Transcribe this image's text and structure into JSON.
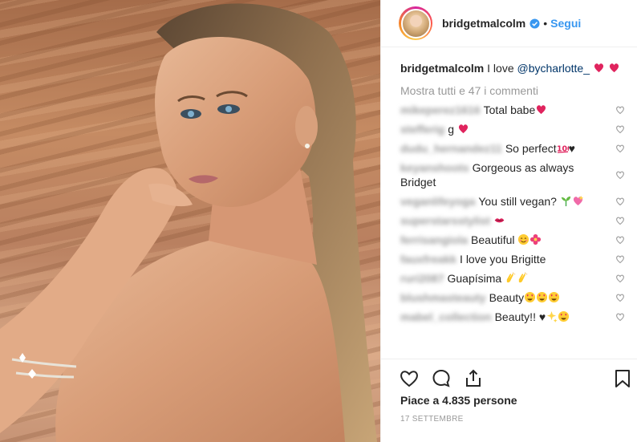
{
  "post": {
    "username": "bridgetmalcolm",
    "separator": "•",
    "follow_label": "Segui",
    "caption_user": "bridgetmalcolm",
    "caption_text": "I love ",
    "caption_mention": "@bycharlotte_",
    "show_all_label": "Mostra tutti e 47 i commenti",
    "likes_label": "Piace a 4.835 persone",
    "date_label": "17 SETTEMBRE"
  },
  "comments": [
    {
      "user": "mikeperez1616",
      "text": "Total babe",
      "emoji": [
        "heart"
      ]
    },
    {
      "user": "stefferig",
      "text": "g ",
      "emoji": [
        "heart"
      ]
    },
    {
      "user": "dudu_hernandez11",
      "text": "So perfect",
      "emoji": [
        "hundred"
      ],
      "suffix": "♥"
    },
    {
      "user": "keyanshoots",
      "text": "Gorgeous as always Bridget",
      "emoji": []
    },
    {
      "user": "veganlifeyoga",
      "text": "You still vegan? ",
      "emoji": [
        "seedling",
        "sparkle-heart"
      ]
    },
    {
      "user": "superstarsstylist",
      "text": "",
      "emoji": [
        "kiss"
      ]
    },
    {
      "user": "ferrisangiola",
      "text": "Beautiful ",
      "emoji": [
        "blush",
        "flower"
      ]
    },
    {
      "user": "fauxfreakk",
      "text": "I love you Brigitte",
      "emoji": []
    },
    {
      "user": "ruri2087",
      "text": "Guapísima ",
      "emoji": [
        "clap",
        "clap"
      ]
    },
    {
      "user": "blushmasteauty",
      "text": "Beauty",
      "emoji": [
        "hearteyes",
        "hearteyes",
        "hearteyes"
      ]
    },
    {
      "user": "mabel_collection",
      "text": "Beauty!! ♥",
      "emoji": [
        "sparkles",
        "hearteyes"
      ]
    }
  ],
  "icons": {
    "verified": "verified-badge-icon",
    "like": "heart-outline-icon",
    "comment": "speech-bubble-icon",
    "share": "share-icon",
    "save": "bookmark-icon"
  },
  "colors": {
    "accent": "#3897f0",
    "heart_red": "#e0245e",
    "muted": "#999999",
    "border": "#efefef"
  }
}
